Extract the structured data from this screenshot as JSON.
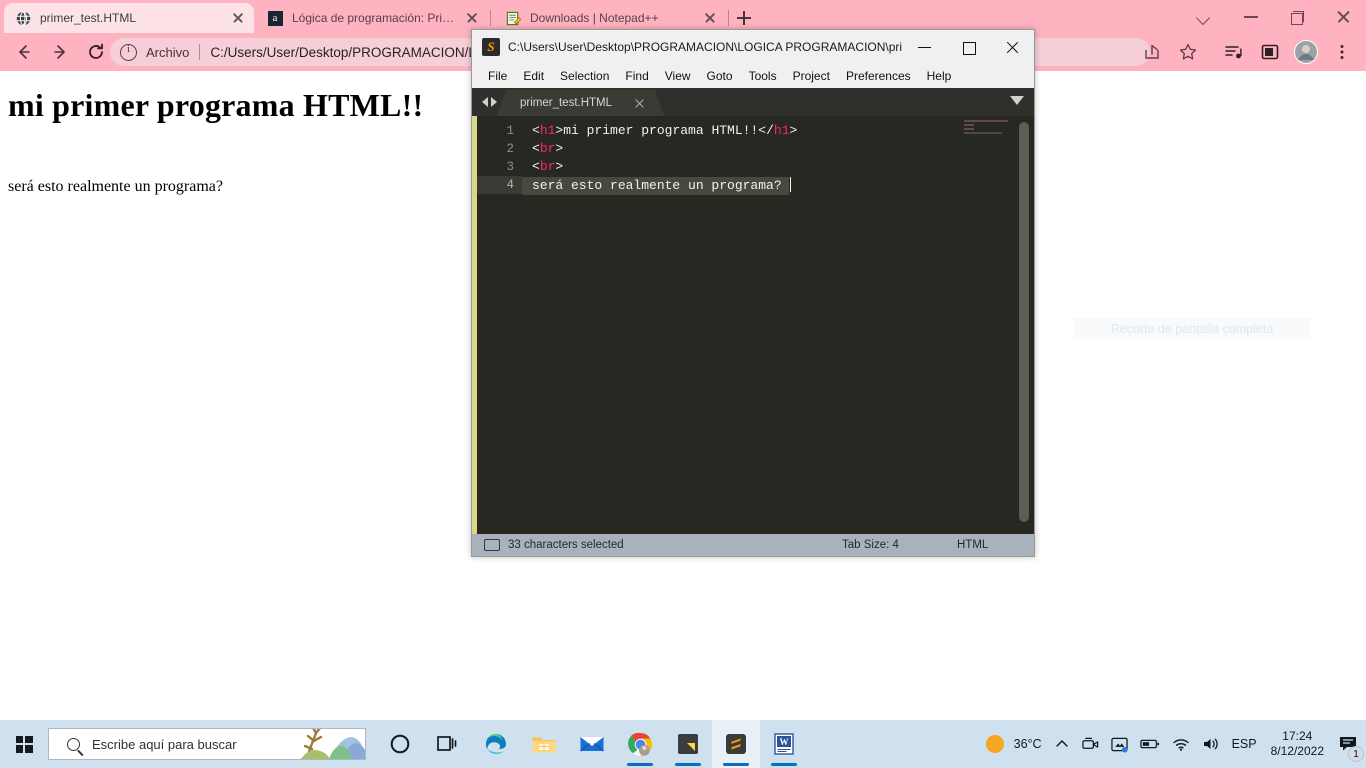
{
  "browser": {
    "tabs": [
      {
        "title": "primer_test.HTML",
        "icon": "globe-icon",
        "active": true
      },
      {
        "title": "Lógica de programación: Primero",
        "icon": "alura-icon",
        "active": false
      },
      {
        "title": "Downloads | Notepad++",
        "icon": "notepad-plus-icon",
        "active": false
      }
    ],
    "new_tab_label": "+",
    "window_controls": [
      "tab-search-chevron",
      "minimize",
      "maximize",
      "close"
    ],
    "omnibox": {
      "scheme_label": "Archivo",
      "url": "C:/Users/User/Desktop/PROGRAMACION/L",
      "info_icon": "info-circle-icon"
    },
    "nav": {
      "back": "←",
      "forward": "→",
      "reload": "C"
    },
    "toolbar_icons": [
      "share-icon",
      "bookmark-star-icon",
      "media-control-icon",
      "sidebar-icon",
      "profile-avatar",
      "chrome-menu-icon"
    ],
    "page": {
      "heading": "mi primer programa HTML!!",
      "paragraph": "será esto realmente un programa?"
    }
  },
  "sublime": {
    "title": "C:\\Users\\User\\Desktop\\PROGRAMACION\\LOGICA PROGRAMACION\\pri...",
    "logo_glyph": "S",
    "window_controls": [
      "minimize",
      "maximize",
      "close"
    ],
    "menu": [
      "File",
      "Edit",
      "Selection",
      "Find",
      "View",
      "Goto",
      "Tools",
      "Project",
      "Preferences",
      "Help"
    ],
    "file_tab": {
      "name": "primer_test.HTML",
      "close_label": "×"
    },
    "gutter": [
      "1",
      "2",
      "3",
      "4"
    ],
    "code": {
      "line1": {
        "open_lt": "<",
        "open_tag": "h1",
        "open_gt": ">",
        "text": "mi primer programa HTML!!",
        "close_lt": "</",
        "close_tag": "h1",
        "close_gt": ">"
      },
      "line2": {
        "lt": "<",
        "tag": "br",
        "gt": ">"
      },
      "line3": {
        "lt": "<",
        "tag": "br",
        "gt": ">"
      },
      "line4": {
        "text": "será esto realmente un programa? "
      }
    },
    "statusbar": {
      "selection": "33 characters selected",
      "tab_size": "Tab Size: 4",
      "syntax": "HTML"
    }
  },
  "snip_tooltip": "Recorte de pantalla completa",
  "taskbar": {
    "start_label": "start-button",
    "search_placeholder": "Escribe aquí para buscar",
    "apps": [
      "cortana-icon",
      "task-view-icon",
      "edge-icon",
      "file-explorer-icon",
      "mail-icon",
      "chrome-icon",
      "sticky-notes-icon",
      "sublime-text-icon",
      "word-icon"
    ],
    "tray": {
      "weather_temp": "36°C",
      "language": "ESP",
      "time": "17:24",
      "date": "8/12/2022",
      "notification_count": "1",
      "icons": [
        "chevron-up-icon",
        "camera-icon",
        "onedrive-icon",
        "battery-icon",
        "wifi-icon",
        "volume-icon"
      ]
    }
  },
  "colors": {
    "chrome_pink": "#ffb3c1",
    "tab_active": "#fde3e8",
    "editor_bg": "#272822",
    "tag_pink": "#f92672",
    "taskbar": "#cfe0ef",
    "status_bar": "#a9b2bc"
  }
}
